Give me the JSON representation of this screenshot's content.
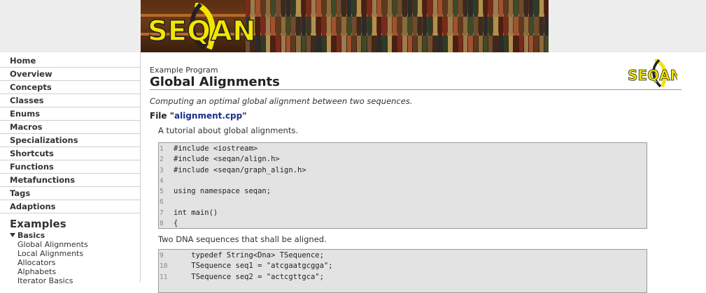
{
  "brand": {
    "logo_text": "SEQAN"
  },
  "sidebar": {
    "items": [
      {
        "label": "Home"
      },
      {
        "label": "Overview"
      },
      {
        "label": "Concepts"
      },
      {
        "label": "Classes"
      },
      {
        "label": "Enums"
      },
      {
        "label": "Macros"
      },
      {
        "label": "Specializations"
      },
      {
        "label": "Shortcuts"
      },
      {
        "label": "Functions"
      },
      {
        "label": "Metafunctions"
      },
      {
        "label": "Tags"
      },
      {
        "label": "Adaptions"
      }
    ],
    "section_title": "Examples",
    "group": {
      "label": "Basics",
      "items": [
        "Global Alignments",
        "Local Alignments",
        "Allocators",
        "Alphabets",
        "Iterator Basics"
      ]
    }
  },
  "page": {
    "pre_title": "Example Program",
    "title": "Global Alignments",
    "subtitle": "Computing an optimal global alignment between two sequences.",
    "file_prefix": "File \"",
    "file_name": "alignment.cpp",
    "file_suffix": "\"",
    "desc1": "A tutorial about global alignments.",
    "desc2": "Two DNA sequences that shall be aligned."
  },
  "code_block_1": [
    {
      "n": "1",
      "t": "#include <iostream>"
    },
    {
      "n": "2",
      "t": "#include <seqan/align.h>"
    },
    {
      "n": "3",
      "t": "#include <seqan/graph_align.h>"
    },
    {
      "n": "4",
      "t": ""
    },
    {
      "n": "5",
      "t": "using namespace seqan;"
    },
    {
      "n": "6",
      "t": ""
    },
    {
      "n": "7",
      "t": "int main()"
    },
    {
      "n": "8",
      "t": "{"
    }
  ],
  "code_block_2": [
    {
      "n": "9",
      "t": "    typedef String<Dna> TSequence;"
    },
    {
      "n": "10",
      "t": "    TSequence seq1 = \"atcgaatgcgga\";"
    },
    {
      "n": "11",
      "t": "    TSequence seq2 = \"actcgttgca\";"
    }
  ],
  "colors": {
    "link": "#1a2e8c",
    "code_bg": "#e3e3e3",
    "logo_yellow": "#f2e600"
  }
}
